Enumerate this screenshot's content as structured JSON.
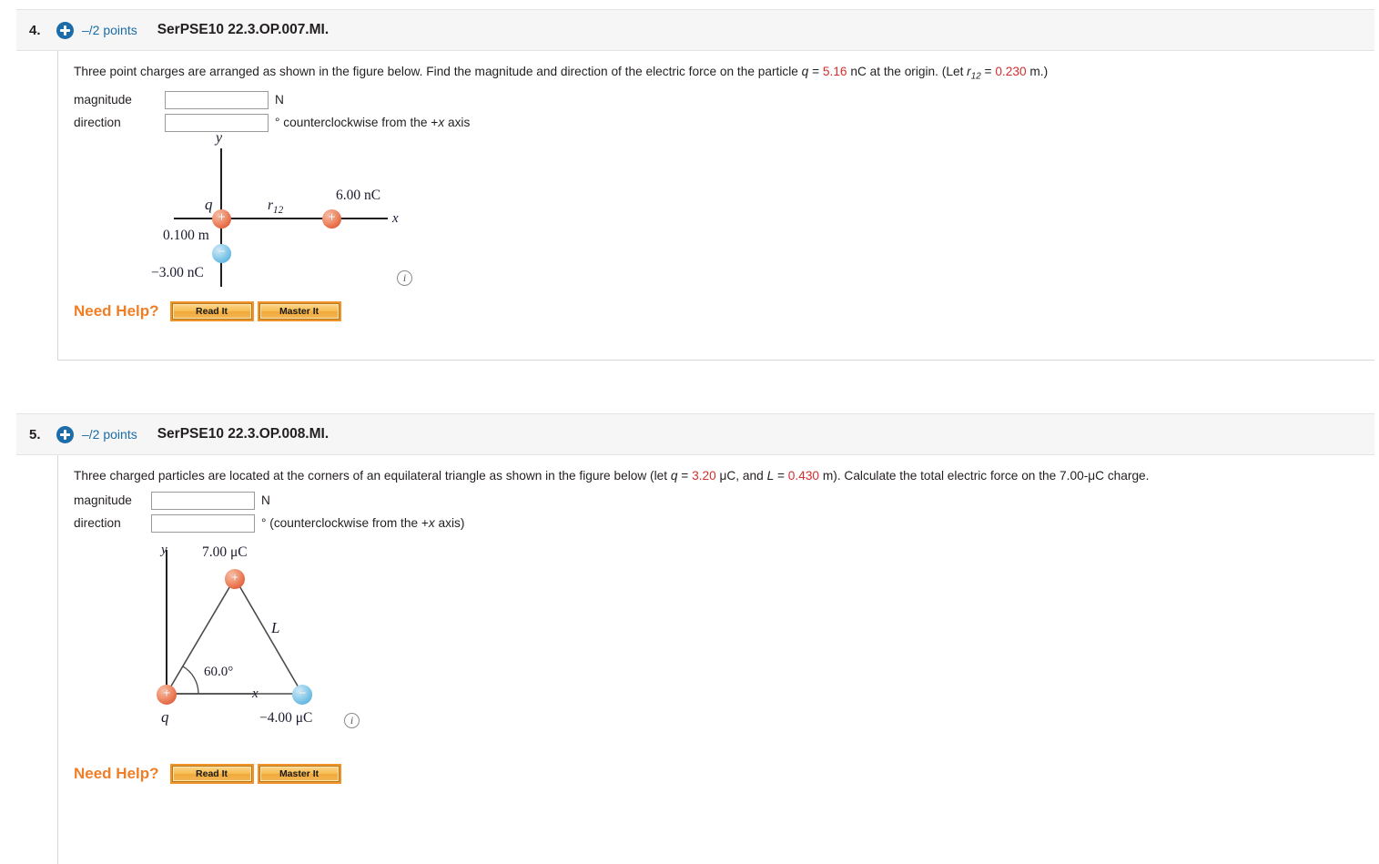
{
  "problems": [
    {
      "number": "4.",
      "points": "–/2 points",
      "code": "SerPSE10 22.3.OP.007.MI.",
      "plus_icon": "plus-circle-icon",
      "prompt": {
        "part1": "Three point charges are arranged as shown in the figure below. Find the magnitude and direction of the electric force on the particle ",
        "var_q": "q",
        "eq1": " = ",
        "q_value": "5.16",
        "part2": " nC at the origin. (Let ",
        "var_r": "r",
        "var_r_sub": "12",
        "eq2": " = ",
        "r_value": "0.230",
        "part3": " m.)"
      },
      "answers": [
        {
          "label": "magnitude",
          "value": "",
          "placeholder": "",
          "unit": "N"
        },
        {
          "label": "direction",
          "value": "",
          "placeholder": "",
          "unit": "° counterclockwise from the +x axis",
          "unit_italic_x": true
        }
      ],
      "figure": {
        "type": "three-point-charges-axes",
        "axis_y_label": "y",
        "axis_x_label": "x",
        "charges": [
          {
            "name": "origin-charge",
            "label": "q",
            "sign": "+",
            "polarity": "pos"
          },
          {
            "name": "right-charge",
            "label": "6.00 nC",
            "sign": "+",
            "polarity": "pos"
          },
          {
            "name": "below-charge",
            "label": "−3.00 nC",
            "sign": "−",
            "polarity": "neg"
          }
        ],
        "distance_label": "0.100 m",
        "separation_label": "r",
        "separation_label_sub": "12",
        "info_icon": "info-icon"
      },
      "need_help": {
        "label": "Need Help?",
        "buttons": [
          "Read It",
          "Master It"
        ]
      }
    },
    {
      "number": "5.",
      "points": "–/2 points",
      "code": "SerPSE10 22.3.OP.008.MI.",
      "plus_icon": "plus-circle-icon",
      "prompt": {
        "part1": "Three charged particles are located at the corners of an equilateral triangle as shown in the figure below (let ",
        "var_q": "q",
        "eq1": " = ",
        "q_value": "3.20",
        "part2": " μC, and ",
        "var_L": "L",
        "eq2": " = ",
        "L_value": "0.430",
        "part3": " m). Calculate the total electric force on the 7.00-μC charge."
      },
      "answers": [
        {
          "label": "magnitude",
          "value": "",
          "placeholder": "",
          "unit": "N"
        },
        {
          "label": "direction",
          "value": "",
          "placeholder": "",
          "unit": "° (counterclockwise from the +x axis)",
          "unit_italic_x": true
        }
      ],
      "figure": {
        "type": "equilateral-triangle-charges",
        "axis_y_label": "y",
        "axis_x_label": "x",
        "charges": [
          {
            "name": "top-charge",
            "label": "7.00 μC",
            "sign": "+",
            "polarity": "pos"
          },
          {
            "name": "bottom-left-charge",
            "label": "q",
            "sign": "+",
            "polarity": "pos"
          },
          {
            "name": "bottom-right-charge",
            "label": "−4.00 μC",
            "sign": "−",
            "polarity": "neg"
          }
        ],
        "side_label": "L",
        "angle_label": "60.0°",
        "info_icon": "info-icon"
      },
      "need_help": {
        "label": "Need Help?",
        "buttons": [
          "Read It",
          "Master It"
        ]
      }
    }
  ],
  "colors": {
    "accent_blue": "#1b6ca8",
    "value_red": "#d32f2f",
    "help_orange": "#f07e26",
    "positive_charge": "#e2603c",
    "negative_charge": "#5fb4e0"
  }
}
